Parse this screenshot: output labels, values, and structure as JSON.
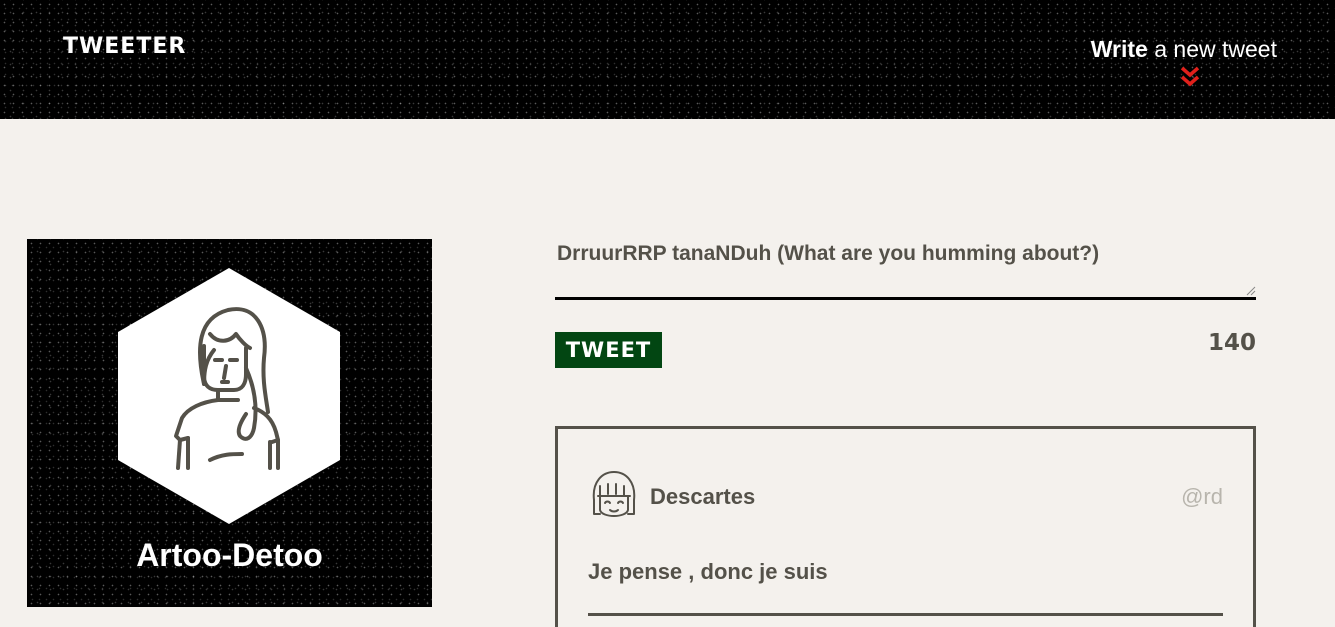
{
  "nav": {
    "brand": "TWEETER",
    "compose_strong": "Write",
    "compose_rest": " a new tweet",
    "compose_icon": "double-chevron-down-icon",
    "accent_color": "#e0201b"
  },
  "profile": {
    "name": "Artoo-Detoo",
    "avatar_icon": "woman-avatar-icon"
  },
  "compose": {
    "placeholder": "DrruurRRP tanaNDuh (What are you humming about?)",
    "button_label": "TWEET",
    "button_color": "#024612",
    "char_count": "140"
  },
  "tweets": [
    {
      "author": "Descartes",
      "handle": "@rd",
      "content": "Je pense , donc je suis",
      "avatar_icon": "girl-avatar-icon"
    }
  ]
}
